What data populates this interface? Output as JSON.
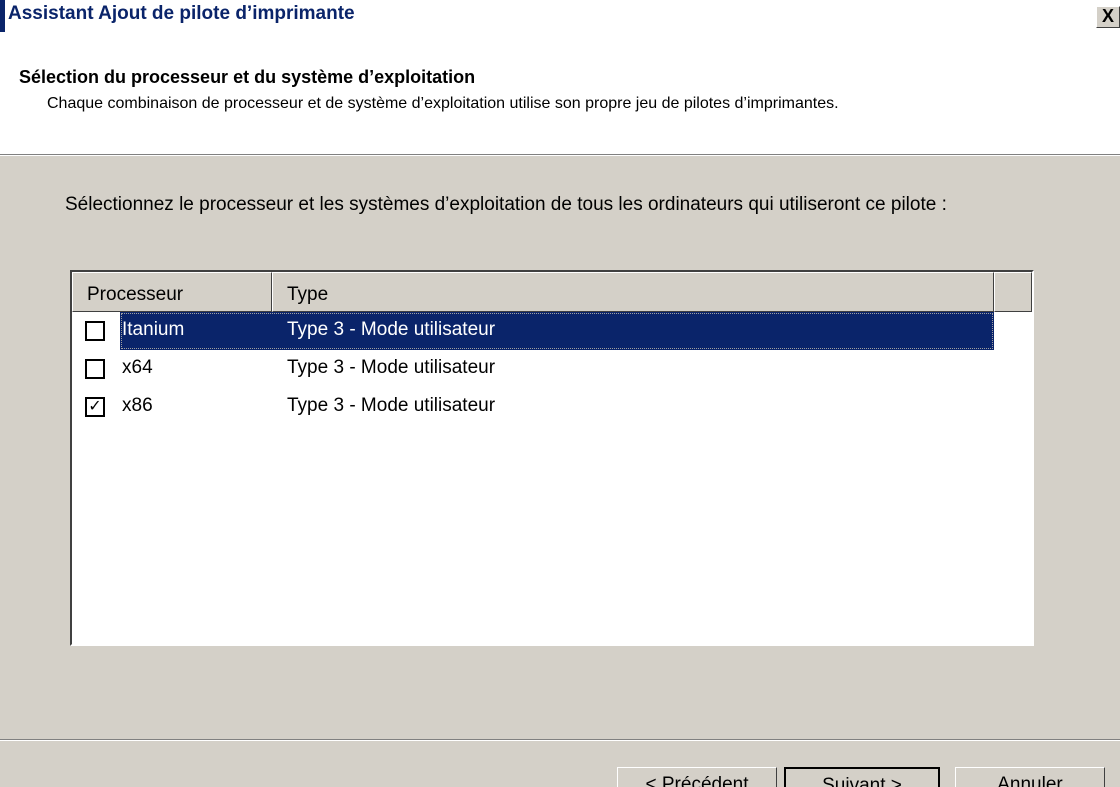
{
  "window": {
    "title": "Assistant Ajout de pilote d’imprimante",
    "close_label": "X"
  },
  "header": {
    "title": "Sélection du processeur et du système d’exploitation",
    "description": "Chaque combinaison de processeur et de système d’exploitation utilise son propre jeu de pilotes d’imprimantes."
  },
  "instruction": "Sélectionnez le processeur et les systèmes d’exploitation de tous les ordinateurs qui utiliseront ce pilote :",
  "list": {
    "columns": [
      "Processeur",
      "Type"
    ],
    "rows": [
      {
        "processor": "Itanium",
        "type": "Type 3 - Mode utilisateur",
        "checked": false,
        "selected": true
      },
      {
        "processor": "x64",
        "type": "Type 3 - Mode utilisateur",
        "checked": false,
        "selected": false
      },
      {
        "processor": "x86",
        "type": "Type 3 - Mode utilisateur",
        "checked": true,
        "selected": false
      }
    ]
  },
  "buttons": {
    "previous": "< Précédent",
    "next": "Suivant >",
    "cancel": "Annuler"
  },
  "colors": {
    "selection": "#0a246a",
    "dialog_bg": "#d4d0c8"
  }
}
